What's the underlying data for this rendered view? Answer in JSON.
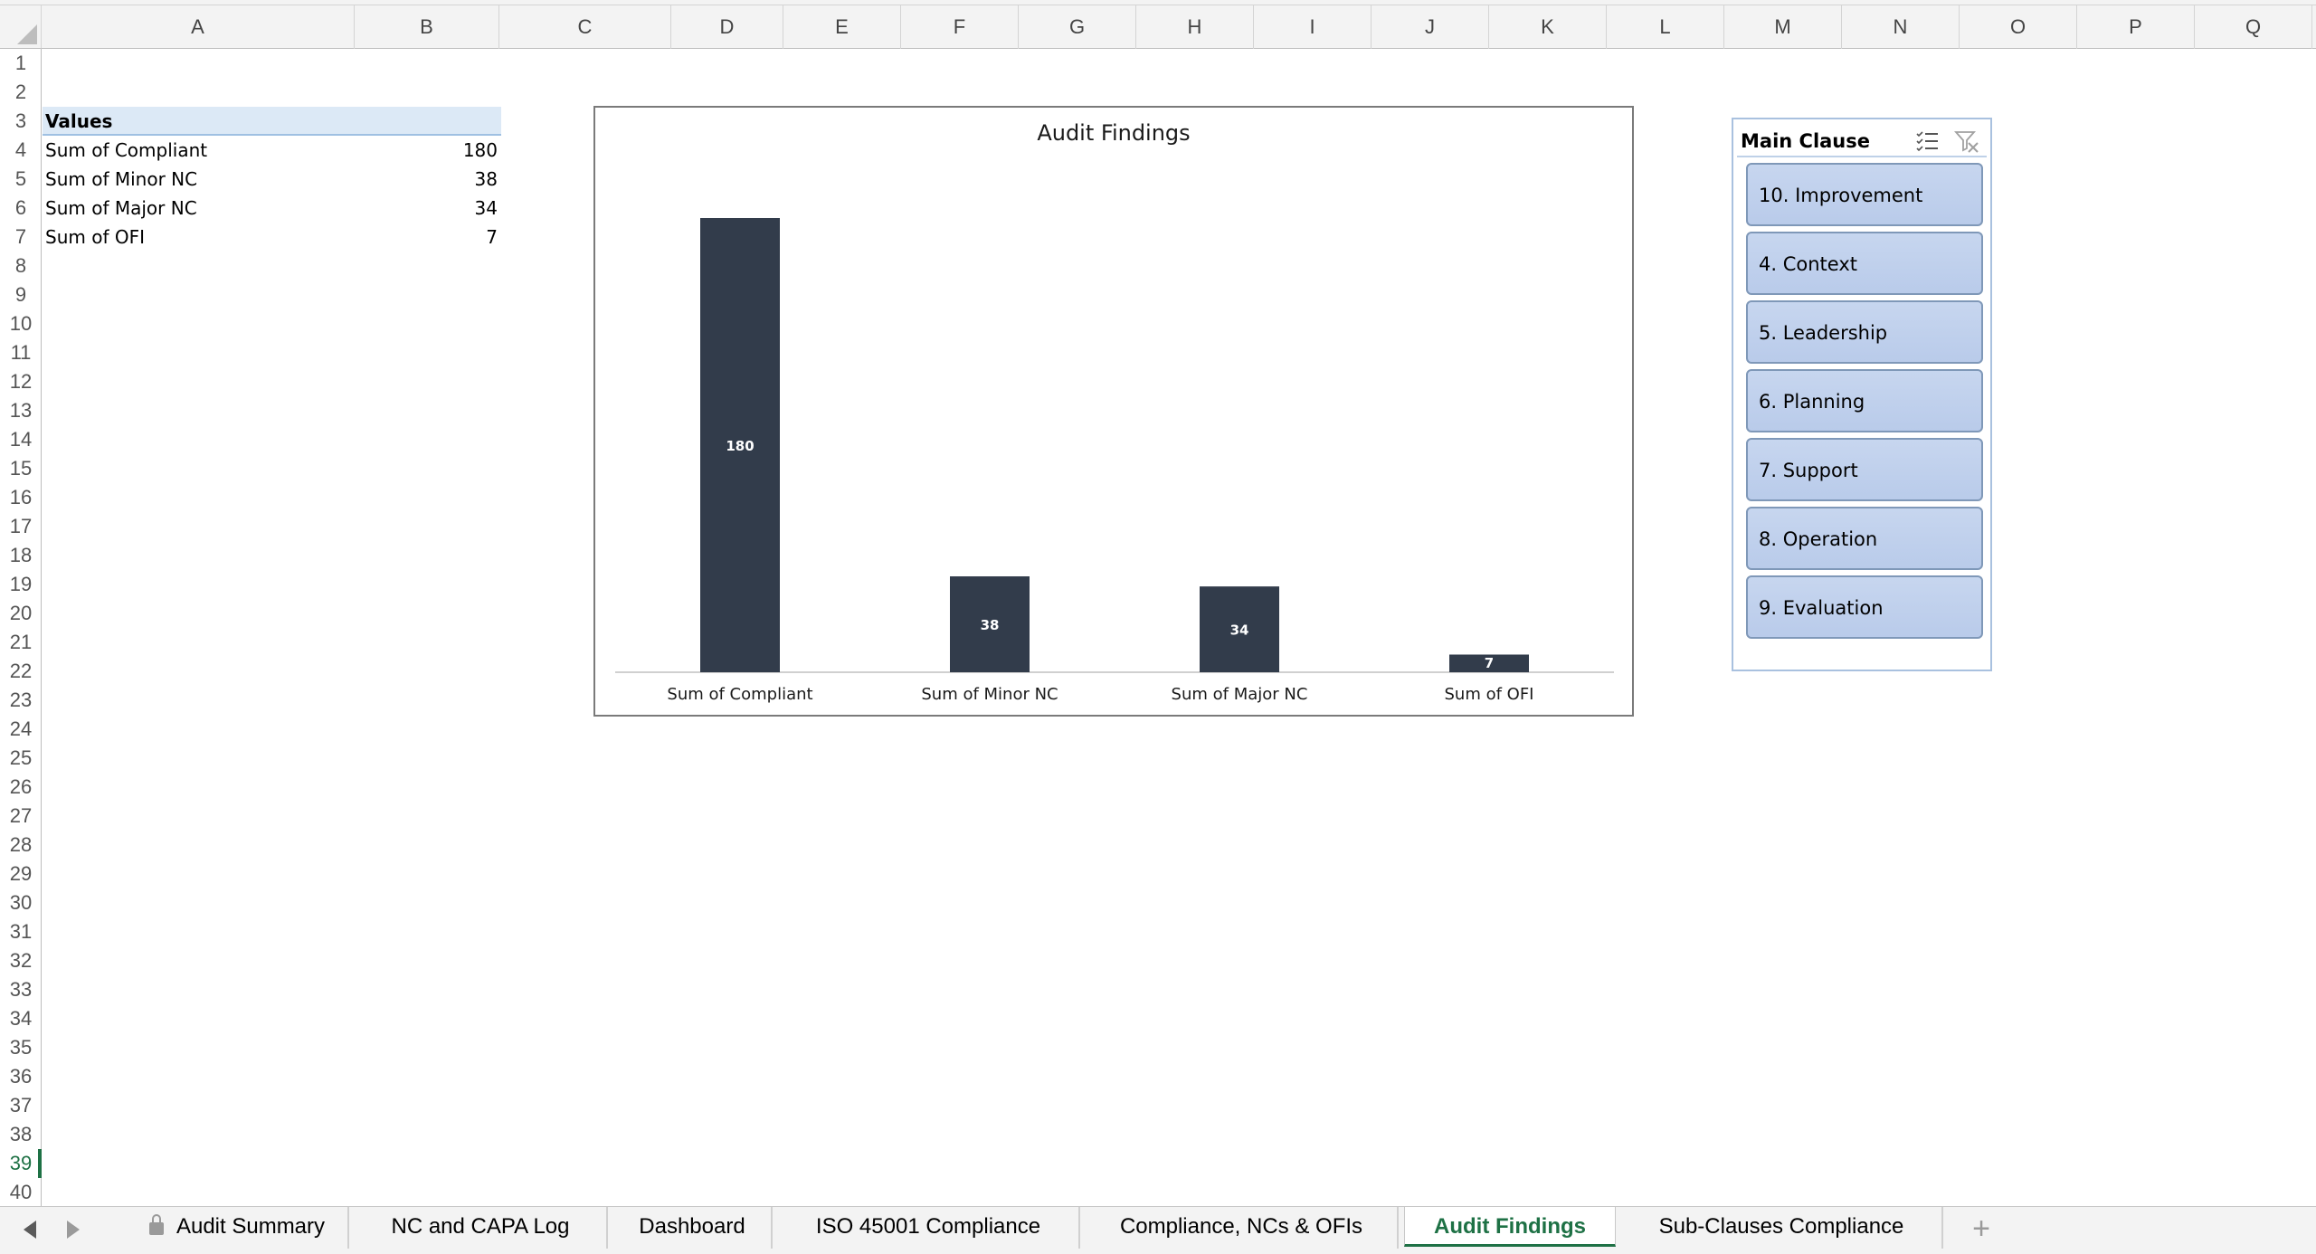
{
  "columns": [
    "A",
    "B",
    "C",
    "D",
    "E",
    "F",
    "G",
    "H",
    "I",
    "J",
    "K",
    "L",
    "M",
    "N",
    "O",
    "P",
    "Q"
  ],
  "rows": [
    "1",
    "2",
    "3",
    "4",
    "5",
    "6",
    "7",
    "8",
    "9",
    "10",
    "11",
    "12",
    "13",
    "14",
    "15",
    "16",
    "17",
    "18",
    "19",
    "20",
    "21",
    "22",
    "23",
    "24",
    "25",
    "26",
    "27",
    "28",
    "29",
    "30",
    "31",
    "32",
    "33",
    "34",
    "35",
    "36",
    "37",
    "38",
    "39",
    "40"
  ],
  "active_row": "39",
  "pivot": {
    "header": "Values",
    "items": [
      {
        "label": "Sum of Compliant",
        "value": "180"
      },
      {
        "label": "Sum of Minor NC",
        "value": "38"
      },
      {
        "label": "Sum of Major NC",
        "value": "34"
      },
      {
        "label": "Sum of OFI",
        "value": "7"
      }
    ]
  },
  "chart_data": {
    "type": "bar",
    "title": "Audit Findings",
    "categories": [
      "Sum of Compliant",
      "Sum of Minor NC",
      "Sum of Major NC",
      "Sum of OFI"
    ],
    "values": [
      180,
      38,
      34,
      7
    ],
    "bar_color": "#323c4b",
    "label_color": "#ffffff",
    "ylim": [
      0,
      180
    ],
    "grid": false,
    "legend": "none"
  },
  "slicer": {
    "title": "Main Clause",
    "icons": [
      "multi-select-icon",
      "clear-filter-icon"
    ],
    "items": [
      "10. Improvement",
      "4. Context",
      "5. Leadership",
      "6. Planning",
      "7. Support",
      "8. Operation",
      "9. Evaluation"
    ]
  },
  "tabs": [
    {
      "label": "Audit Summary",
      "locked": true
    },
    {
      "label": "NC and CAPA Log"
    },
    {
      "label": "Dashboard"
    },
    {
      "label": "ISO 45001 Compliance"
    },
    {
      "label": "Compliance, NCs & OFIs"
    },
    {
      "label": "Audit Findings",
      "active": true
    },
    {
      "label": "Sub-Clauses Compliance"
    }
  ],
  "add_sheet_label": "+",
  "colors": {
    "accent": "#1e7145",
    "pivot_header": "#dce9f6",
    "slicer_item": "#c7d6ef"
  }
}
